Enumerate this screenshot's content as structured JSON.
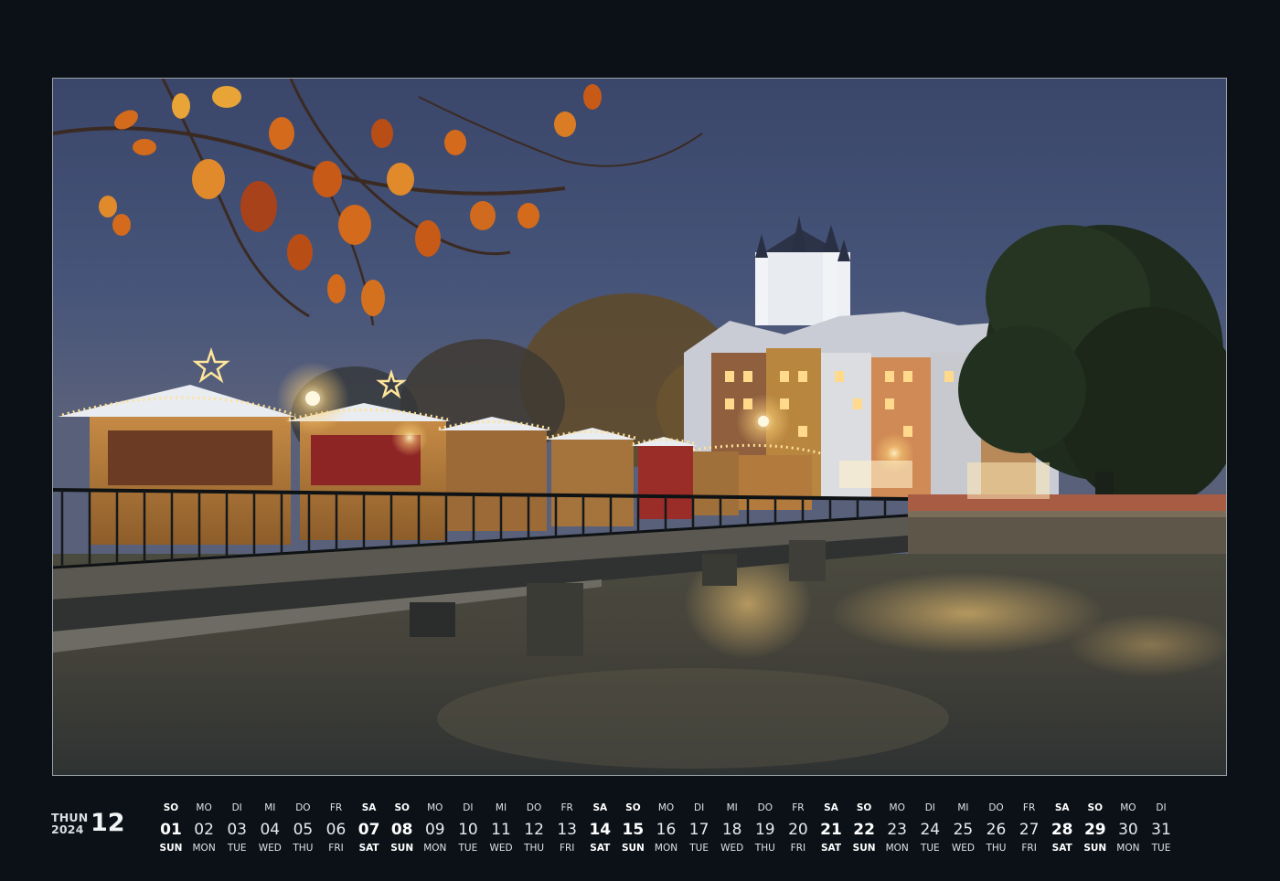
{
  "calendar": {
    "place": "THUN",
    "year": "2024",
    "month": "12",
    "days": [
      {
        "de": "SO",
        "num": "01",
        "en": "SUN",
        "weekend": true
      },
      {
        "de": "MO",
        "num": "02",
        "en": "MON",
        "weekend": false
      },
      {
        "de": "DI",
        "num": "03",
        "en": "TUE",
        "weekend": false
      },
      {
        "de": "MI",
        "num": "04",
        "en": "WED",
        "weekend": false
      },
      {
        "de": "DO",
        "num": "05",
        "en": "THU",
        "weekend": false
      },
      {
        "de": "FR",
        "num": "06",
        "en": "FRI",
        "weekend": false
      },
      {
        "de": "SA",
        "num": "07",
        "en": "SAT",
        "weekend": true
      },
      {
        "de": "SO",
        "num": "08",
        "en": "SUN",
        "weekend": true
      },
      {
        "de": "MO",
        "num": "09",
        "en": "MON",
        "weekend": false
      },
      {
        "de": "DI",
        "num": "10",
        "en": "TUE",
        "weekend": false
      },
      {
        "de": "MI",
        "num": "11",
        "en": "WED",
        "weekend": false
      },
      {
        "de": "DO",
        "num": "12",
        "en": "THU",
        "weekend": false
      },
      {
        "de": "FR",
        "num": "13",
        "en": "FRI",
        "weekend": false
      },
      {
        "de": "SA",
        "num": "14",
        "en": "SAT",
        "weekend": true
      },
      {
        "de": "SO",
        "num": "15",
        "en": "SUN",
        "weekend": true
      },
      {
        "de": "MO",
        "num": "16",
        "en": "MON",
        "weekend": false
      },
      {
        "de": "DI",
        "num": "17",
        "en": "TUE",
        "weekend": false
      },
      {
        "de": "MI",
        "num": "18",
        "en": "WED",
        "weekend": false
      },
      {
        "de": "DO",
        "num": "19",
        "en": "THU",
        "weekend": false
      },
      {
        "de": "FR",
        "num": "20",
        "en": "FRI",
        "weekend": false
      },
      {
        "de": "SA",
        "num": "21",
        "en": "SAT",
        "weekend": true
      },
      {
        "de": "SO",
        "num": "22",
        "en": "SUN",
        "weekend": true
      },
      {
        "de": "MO",
        "num": "23",
        "en": "MON",
        "weekend": false
      },
      {
        "de": "DI",
        "num": "24",
        "en": "TUE",
        "weekend": false
      },
      {
        "de": "MI",
        "num": "25",
        "en": "WED",
        "weekend": false
      },
      {
        "de": "DO",
        "num": "26",
        "en": "THU",
        "weekend": false
      },
      {
        "de": "FR",
        "num": "27",
        "en": "FRI",
        "weekend": false
      },
      {
        "de": "SA",
        "num": "28",
        "en": "SAT",
        "weekend": true
      },
      {
        "de": "SO",
        "num": "29",
        "en": "SUN",
        "weekend": true
      },
      {
        "de": "MO",
        "num": "30",
        "en": "MON",
        "weekend": false
      },
      {
        "de": "DI",
        "num": "31",
        "en": "TUE",
        "weekend": false
      }
    ]
  },
  "colors": {
    "page_background": "#0b1117",
    "night_sky": "#3a4669",
    "river": "#3b3a33",
    "stall_wood": "#b07a3a",
    "warm_light": "#ffd27a",
    "autumn_leaves": "#d36a1c",
    "tree_green": "#22311f"
  }
}
